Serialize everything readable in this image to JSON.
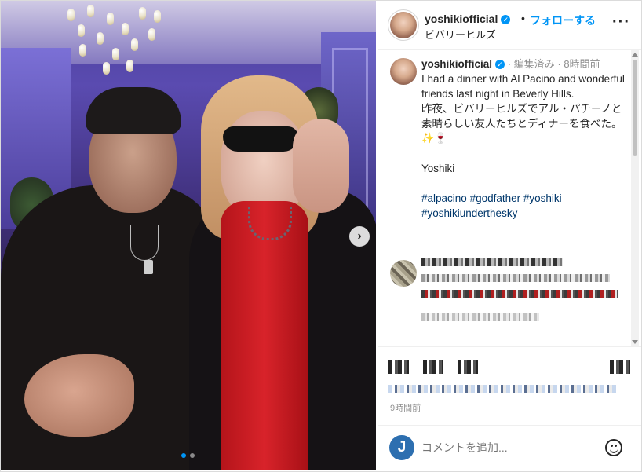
{
  "post": {
    "username": "yoshikiofficial",
    "follow_label": "フォローする",
    "location": "ビバリーヒルズ",
    "more_label": "···",
    "carousel_next": "›"
  },
  "caption": {
    "username": "yoshikiofficial",
    "edited": "編集済み",
    "time": "8時間前",
    "line1": "I had a dinner with Al Pacino and wonderful friends last night in Beverly Hills.",
    "line2": "昨夜、ビバリーヒルズでアル・パチーノと素晴らしい友人たちとディナーを食べた。",
    "line3": "✨🍷",
    "signature": "Yoshiki",
    "hashtags": [
      "#alpacino",
      "#godfather",
      "#yoshiki",
      "#yoshikiunderthesky"
    ]
  },
  "footer": {
    "timestamp": "9時間前"
  },
  "comment_box": {
    "avatar_letter": "J",
    "placeholder": "コメントを追加..."
  },
  "colors": {
    "accent": "#0095f6",
    "hashtag": "#00376b",
    "scarf": "#d8232a"
  },
  "icons": {
    "verified": "verified-badge-icon",
    "more": "more-options-icon",
    "emoji": "emoji-smile-icon",
    "next": "chevron-right-icon"
  },
  "carousel": {
    "current": 1,
    "total": 2
  }
}
